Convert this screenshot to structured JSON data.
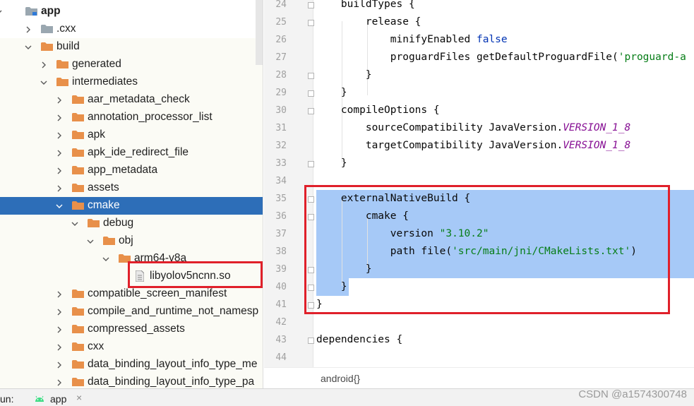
{
  "tree": {
    "items": [
      {
        "label": "app",
        "expanded": true,
        "icon": "module-folder-icon",
        "bold": true
      },
      {
        "label": ".cxx",
        "expanded": false,
        "icon": "folder-icon"
      },
      {
        "label": "build",
        "expanded": true,
        "icon": "folder-icon"
      },
      {
        "label": "generated",
        "expanded": false,
        "icon": "folder-icon"
      },
      {
        "label": "intermediates",
        "expanded": true,
        "icon": "folder-icon"
      },
      {
        "label": "aar_metadata_check",
        "expanded": false,
        "icon": "folder-icon"
      },
      {
        "label": "annotation_processor_list",
        "expanded": false,
        "icon": "folder-icon"
      },
      {
        "label": "apk",
        "expanded": false,
        "icon": "folder-icon"
      },
      {
        "label": "apk_ide_redirect_file",
        "expanded": false,
        "icon": "folder-icon"
      },
      {
        "label": "app_metadata",
        "expanded": false,
        "icon": "folder-icon"
      },
      {
        "label": "assets",
        "expanded": false,
        "icon": "folder-icon"
      },
      {
        "label": "cmake",
        "expanded": true,
        "icon": "folder-icon",
        "selected": true
      },
      {
        "label": "debug",
        "expanded": true,
        "icon": "folder-icon"
      },
      {
        "label": "obj",
        "expanded": true,
        "icon": "folder-icon"
      },
      {
        "label": "arm64-v8a",
        "expanded": true,
        "icon": "folder-icon"
      },
      {
        "label": "libyolov5ncnn.so",
        "icon": "file-icon"
      },
      {
        "label": "compatible_screen_manifest",
        "expanded": false,
        "icon": "folder-icon"
      },
      {
        "label": "compile_and_runtime_not_namesp",
        "expanded": false,
        "icon": "folder-icon"
      },
      {
        "label": "compressed_assets",
        "expanded": false,
        "icon": "folder-icon"
      },
      {
        "label": "cxx",
        "expanded": false,
        "icon": "folder-icon"
      },
      {
        "label": "data_binding_layout_info_type_me",
        "expanded": false,
        "icon": "folder-icon"
      },
      {
        "label": "data_binding_layout_info_type_pa",
        "expanded": false,
        "icon": "folder-icon"
      }
    ]
  },
  "editor": {
    "lines": [
      {
        "n": "24",
        "text": "    buildTypes {"
      },
      {
        "n": "25",
        "text": "        release {"
      },
      {
        "n": "26",
        "text": "            minifyEnabled false"
      },
      {
        "n": "27",
        "text": "            proguardFiles getDefaultProguardFile('proguard-a"
      },
      {
        "n": "28",
        "text": "        }"
      },
      {
        "n": "29",
        "text": "    }"
      },
      {
        "n": "30",
        "text": "    compileOptions {"
      },
      {
        "n": "31",
        "text": "        sourceCompatibility JavaVersion.VERSION_1_8"
      },
      {
        "n": "32",
        "text": "        targetCompatibility JavaVersion.VERSION_1_8"
      },
      {
        "n": "33",
        "text": "    }"
      },
      {
        "n": "34",
        "text": ""
      },
      {
        "n": "35",
        "text": "    externalNativeBuild {"
      },
      {
        "n": "36",
        "text": "        cmake {"
      },
      {
        "n": "37",
        "text": "            version \"3.10.2\""
      },
      {
        "n": "38",
        "text": "            path file('src/main/jni/CMakeLists.txt')"
      },
      {
        "n": "39",
        "text": "        }"
      },
      {
        "n": "40",
        "text": "    }"
      },
      {
        "n": "41",
        "text": "}"
      },
      {
        "n": "42",
        "text": ""
      },
      {
        "n": "43",
        "text": "dependencies {"
      },
      {
        "n": "44",
        "text": ""
      }
    ],
    "breadcrumb": "android{}"
  },
  "bottom": {
    "run_label": "un:",
    "app_tab": "app",
    "close_glyph": "×"
  },
  "watermark": "CSDN @a1574300748"
}
